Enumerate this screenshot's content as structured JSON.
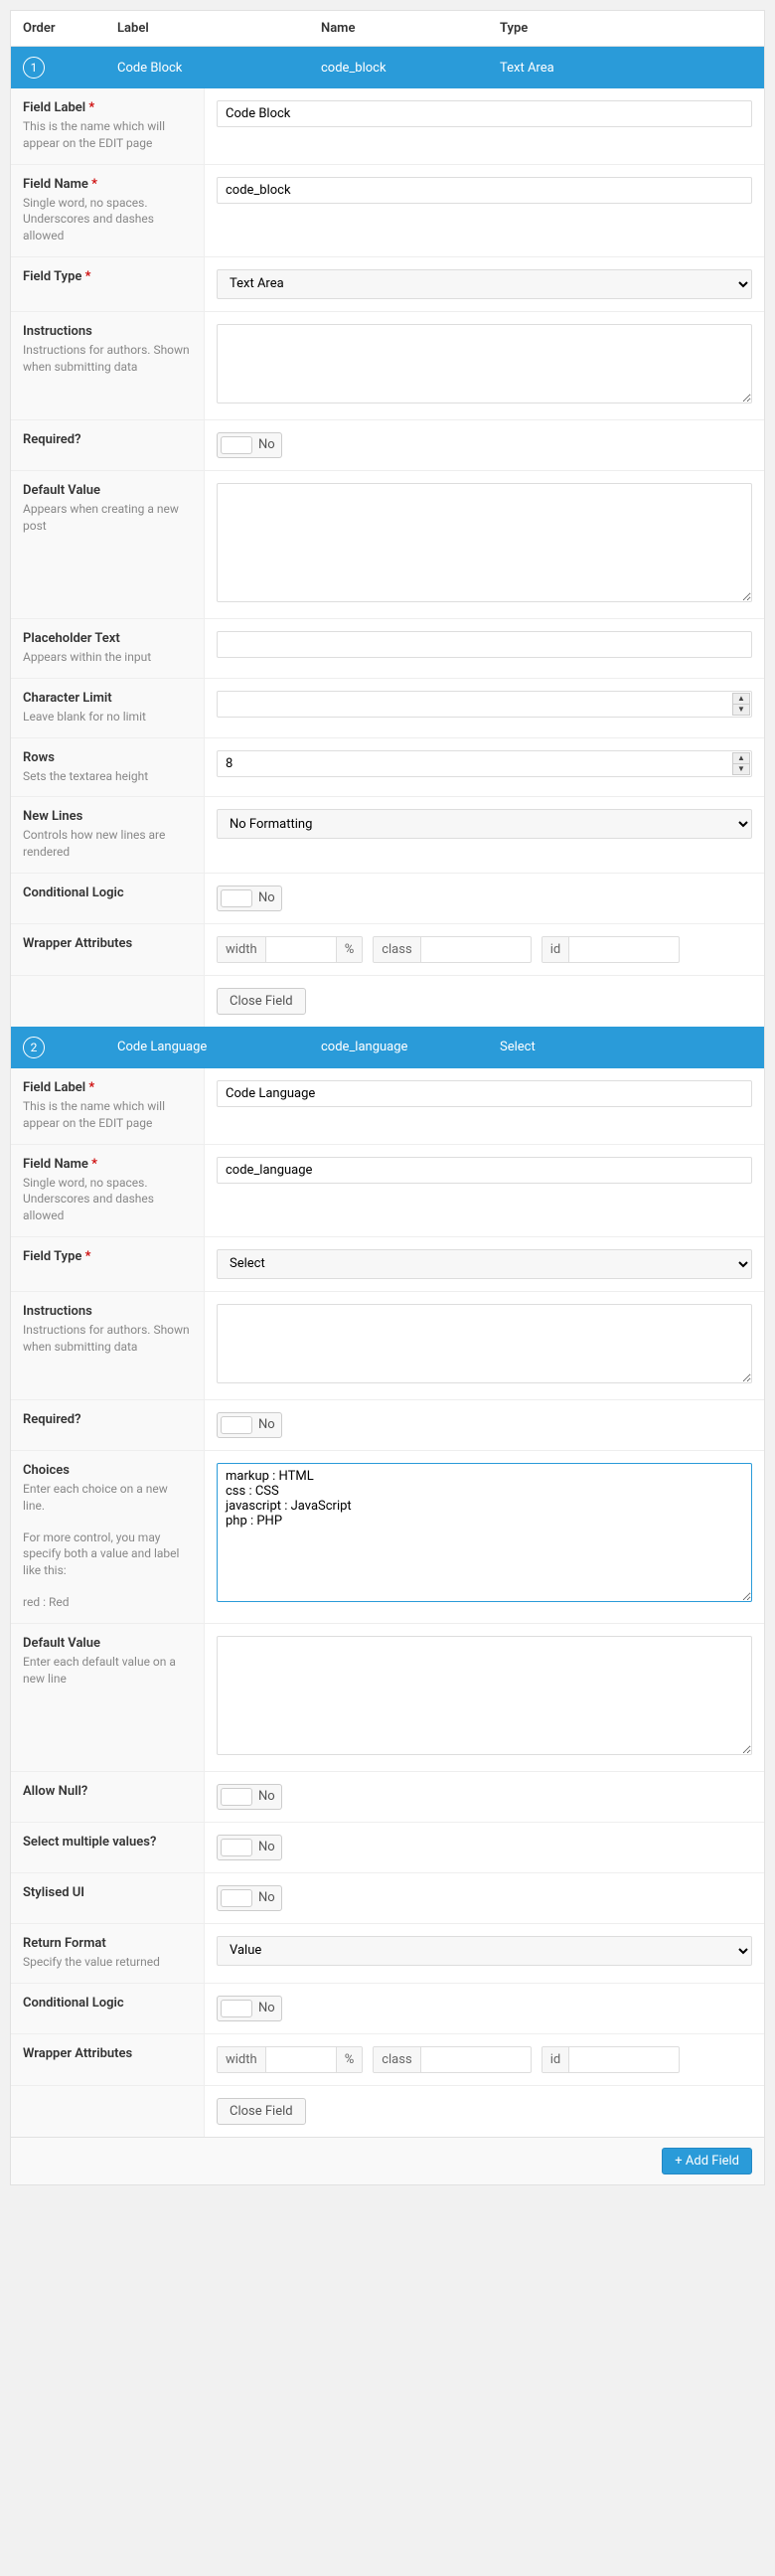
{
  "header": {
    "order": "Order",
    "label": "Label",
    "name": "Name",
    "type": "Type"
  },
  "toggle_no": "No",
  "wrapper": {
    "width": "width",
    "pct": "%",
    "class": "class",
    "id": "id"
  },
  "close_field": "Close Field",
  "add_field": "+ Add Field",
  "labels": {
    "field_label": "Field Label",
    "field_label_desc": "This is the name which will appear on the EDIT page",
    "field_name": "Field Name",
    "field_name_desc": "Single word, no spaces. Underscores and dashes allowed",
    "field_type": "Field Type",
    "instructions": "Instructions",
    "instructions_desc": "Instructions for authors. Shown when submitting data",
    "required": "Required?",
    "default_value": "Default Value",
    "default_value_desc1": "Appears when creating a new post",
    "default_value_desc2": "Enter each default value on a new line",
    "placeholder": "Placeholder Text",
    "placeholder_desc": "Appears within the input",
    "char_limit": "Character Limit",
    "char_limit_desc": "Leave blank for no limit",
    "rows": "Rows",
    "rows_desc": "Sets the textarea height",
    "new_lines": "New Lines",
    "new_lines_desc": "Controls how new lines are rendered",
    "conditional": "Conditional Logic",
    "wrapper_attrs": "Wrapper Attributes",
    "choices": "Choices",
    "choices_desc1": "Enter each choice on a new line.",
    "choices_desc2": "For more control, you may specify both a value and label like this:",
    "choices_desc3": "red : Red",
    "allow_null": "Allow Null?",
    "select_multi": "Select multiple values?",
    "stylised": "Stylised UI",
    "return_format": "Return Format",
    "return_format_desc": "Specify the value returned"
  },
  "fields": [
    {
      "order": "1",
      "label": "Code Block",
      "name": "code_block",
      "type": "Text Area",
      "rows_value": "8",
      "new_lines_value": "No Formatting"
    },
    {
      "order": "2",
      "label": "Code Language",
      "name": "code_language",
      "type": "Select",
      "choices_value": "markup : HTML\ncss : CSS\njavascript : JavaScript\nphp : PHP",
      "return_format_value": "Value"
    }
  ]
}
